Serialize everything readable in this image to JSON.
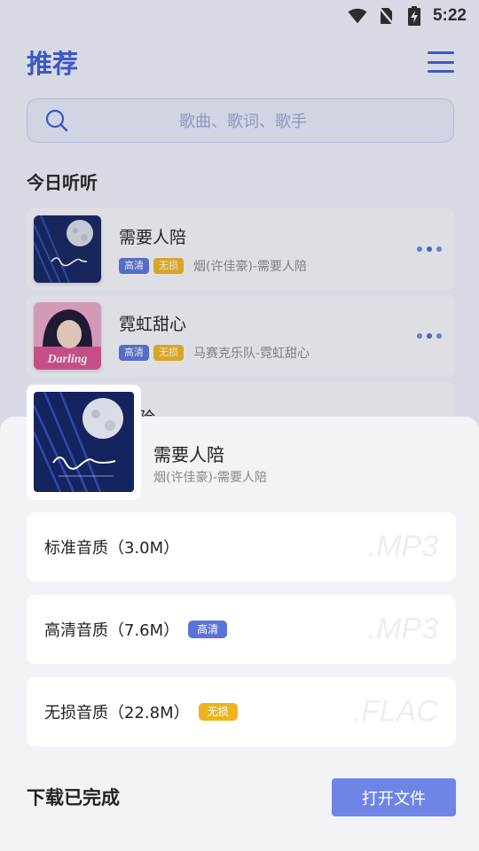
{
  "status_bar": {
    "time": "5:22"
  },
  "header": {
    "title": "推荐"
  },
  "search": {
    "placeholder": "歌曲、歌词、歌手"
  },
  "section": {
    "title": "今日听听"
  },
  "songs": [
    {
      "title": "需要人陪",
      "badge_hd": "高清",
      "badge_lossless": "无损",
      "subtitle": "烟(许佳豪)-需要人陪"
    },
    {
      "title": "霓虹甜心",
      "badge_hd": "高清",
      "badge_lossless": "无损",
      "subtitle": "马赛克乐队-霓虹甜心"
    },
    {
      "title_partial": "险"
    }
  ],
  "sheet": {
    "song_title": "需要人陪",
    "song_subtitle": "烟(许佳豪)-需要人陪",
    "qualities": [
      {
        "label": "标准音质（3.0M）",
        "badge": "",
        "format": ".MP3"
      },
      {
        "label": "高清音质（7.6M）",
        "badge": "高清",
        "format": ".MP3"
      },
      {
        "label": "无损音质（22.8M）",
        "badge": "无损",
        "format": ".FLAC"
      }
    ],
    "status": "下载已完成",
    "open_button": "打开文件"
  },
  "colors": {
    "accent": "#3d5bd6",
    "button": "#6e85e6",
    "badge_hd": "#5b73d8",
    "badge_lossless": "#eeb41d"
  }
}
